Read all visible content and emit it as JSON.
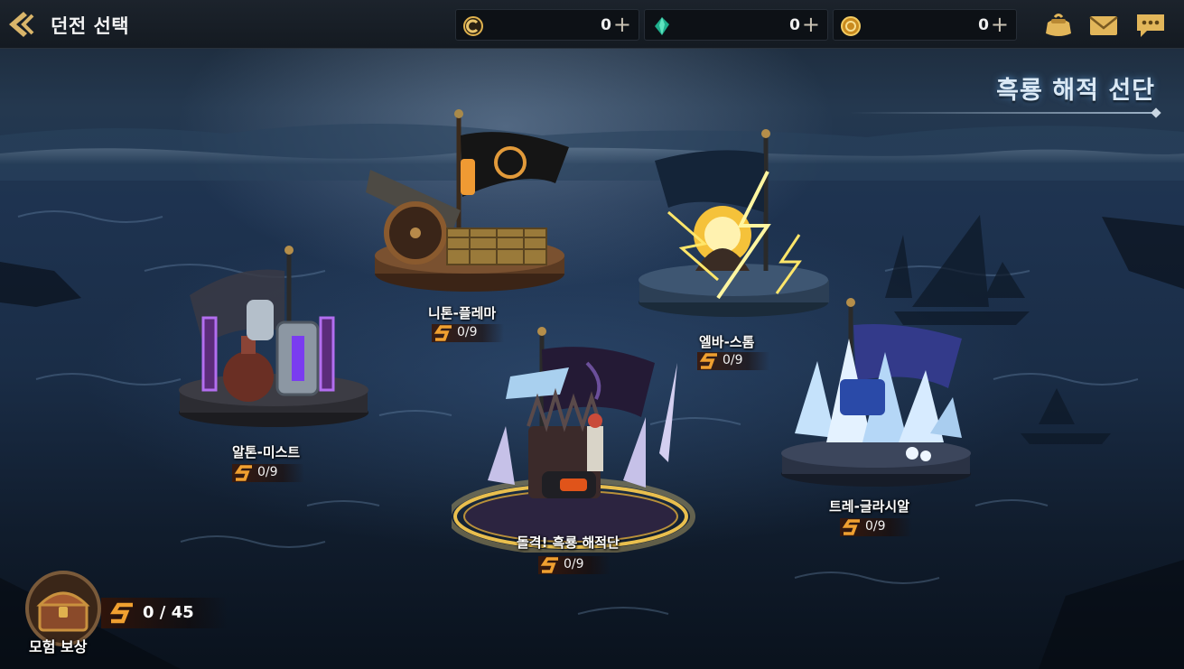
{
  "header": {
    "title": "던전 선택",
    "currencies": [
      {
        "icon": "c-coin-icon",
        "value": "0"
      },
      {
        "icon": "green-gem-icon",
        "value": "0"
      },
      {
        "icon": "gold-coin-icon",
        "value": "0"
      }
    ],
    "plus_label": "+",
    "icons": [
      "pouch-icon",
      "mail-icon",
      "chat-icon"
    ]
  },
  "region": {
    "title": "흑룡 해적 선단"
  },
  "dungeons": [
    {
      "name": "니톤-플레마",
      "progress": "0/9",
      "theme": "cannon"
    },
    {
      "name": "엘바-스톰",
      "progress": "0/9",
      "theme": "lightning"
    },
    {
      "name": "알톤-미스트",
      "progress": "0/9",
      "theme": "tanks"
    },
    {
      "name": "돌격! 흑룡 해적단",
      "progress": "0/9",
      "theme": "throne"
    },
    {
      "name": "트레-글라시알",
      "progress": "0/9",
      "theme": "ice"
    }
  ],
  "reward": {
    "label": "모험 보상",
    "progress": "0 / 45"
  },
  "colors": {
    "accent_gold": "#e8a23a",
    "title_glow": "#5a96d2",
    "progress_s": "#f0a030"
  }
}
